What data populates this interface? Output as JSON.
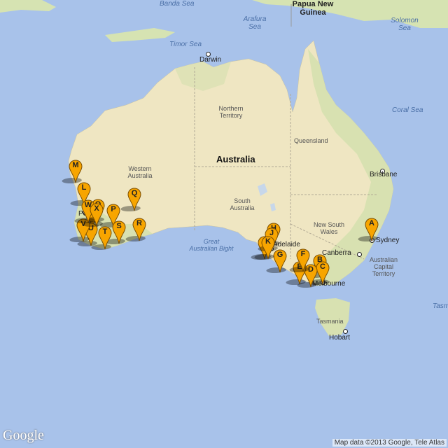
{
  "labels": {
    "banda_sea": "Banda Sea",
    "papua_new_guinea": "Papua New Guinea",
    "arafura_sea": "Arafura Sea",
    "timor_sea": "Timor Sea",
    "solomon_sea": "Solomon Sea",
    "coral_sea": "Coral Sea",
    "darwin": "Darwin",
    "northern_territory": "Northern Territory",
    "queensland": "Queensland",
    "australia": "Australia",
    "western_australia": "Western Australia",
    "brisbane": "Brisbane",
    "south_australia": "South Australia",
    "new_south_wales": "New South Wales",
    "sydney": "Sydney",
    "canberra": "Canberra",
    "act": "Australian Capital Territory",
    "great_australian_bight": "Great Australian Bight",
    "adelaide": "Adelaide",
    "melbourne": "Melbourne",
    "tasmania": "Tasmania",
    "hobart": "Hobart",
    "perth": "Perth",
    "tasman": "Tasm"
  },
  "markers": [
    "A",
    "B",
    "C",
    "D",
    "E",
    "F",
    "G",
    "H",
    "I",
    "J",
    "K",
    "L",
    "M",
    "N",
    "O",
    "P",
    "Q",
    "R",
    "S",
    "T",
    "U",
    "V",
    "W",
    "X"
  ],
  "branding": {
    "logo": "Google",
    "attribution": "Map data ©2013 Google, Tele Atlas"
  },
  "colors": {
    "water": "#a8c2ea",
    "land": "#eee8c8",
    "desert": "#e9dfb3",
    "green": "#cde0a6",
    "marker": "#f7a500"
  }
}
